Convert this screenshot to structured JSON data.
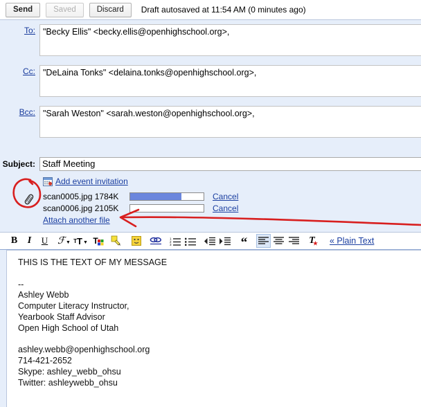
{
  "toolbar": {
    "send_label": "Send",
    "saved_label": "Saved",
    "discard_label": "Discard",
    "autosave_status": "Draft autosaved at 11:54 AM (0 minutes ago)"
  },
  "fields": {
    "to_label": "To:",
    "to_value": "\"Becky Ellis\" <becky.ellis@openhighschool.org>,",
    "cc_label": "Cc:",
    "cc_value": "\"DeLaina Tonks\" <delaina.tonks@openhighschool.org>,",
    "bcc_label": "Bcc:",
    "bcc_value": "\"Sarah Weston\" <sarah.weston@openhighschool.org>,",
    "subject_label": "Subject:",
    "subject_value": "Staff Meeting"
  },
  "event": {
    "icon": "calendar-icon",
    "link_label": "Add event invitation"
  },
  "attachments": {
    "clip_icon": "paperclip-icon",
    "items": [
      {
        "name": "scan0005.jpg",
        "size": "1784K",
        "progress": 70,
        "cancel_label": "Cancel"
      },
      {
        "name": "scan0006.jpg",
        "size": "2105K",
        "progress": 0,
        "cancel_label": "Cancel"
      }
    ],
    "attach_more_label": "Attach another file"
  },
  "format_bar": {
    "buttons": [
      {
        "name": "bold-icon",
        "glyph": "B"
      },
      {
        "name": "italic-icon",
        "glyph": "I"
      },
      {
        "name": "underline-icon",
        "glyph": "U"
      },
      {
        "name": "font-family-icon",
        "glyph": "ℱ"
      },
      {
        "name": "font-size-icon",
        "glyph": "TT"
      },
      {
        "name": "text-color-icon",
        "glyph": "T"
      },
      {
        "name": "highlight-color-icon",
        "glyph": "✎"
      },
      {
        "name": "emoji-icon",
        "glyph": "☺"
      },
      {
        "name": "insert-link-icon",
        "glyph": "∞"
      },
      {
        "name": "numbered-list-icon",
        "glyph": "≡"
      },
      {
        "name": "bulleted-list-icon",
        "glyph": "≡"
      },
      {
        "name": "outdent-icon",
        "glyph": "◀"
      },
      {
        "name": "indent-icon",
        "glyph": "▶"
      },
      {
        "name": "blockquote-icon",
        "glyph": "“"
      },
      {
        "name": "align-left-icon",
        "glyph": "≡"
      },
      {
        "name": "align-center-icon",
        "glyph": "≡"
      },
      {
        "name": "align-right-icon",
        "glyph": "≡"
      },
      {
        "name": "remove-formatting-icon",
        "glyph": "T"
      }
    ],
    "plain_text_label": "« Plain Text"
  },
  "message_body": "THIS IS THE TEXT OF MY MESSAGE\n\n--\nAshley Webb\nComputer Literacy Instructor,\nYearbook Staff Advisor\nOpen High School of Utah\n\nashley.webb@openhighschool.org\n714-421-2652\nSkype: ashley_webb_ohsu\nTwitter: ashleywebb_ohsu",
  "annotations": {
    "circle_target": "paperclip-icon",
    "arrow_target": "attach-another-file-link",
    "color": "#d81f1f"
  },
  "colors": {
    "header_bg": "#e6eefa",
    "link": "#1a3ea0",
    "progress_fill": "#6b86dd",
    "annotation_red": "#d81f1f"
  }
}
